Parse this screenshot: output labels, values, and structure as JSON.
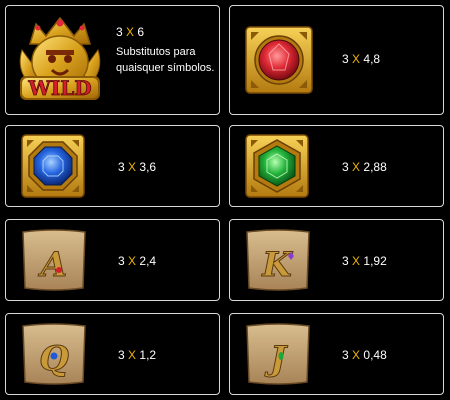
{
  "paytable": [
    {
      "symbol": "wild",
      "count": "3",
      "x": "X",
      "multiplier": "6",
      "description": "Substitutos para quaisquer símbolos."
    },
    {
      "symbol": "red-gem",
      "count": "3",
      "x": "X",
      "multiplier": "4,8"
    },
    {
      "symbol": "blue-gem",
      "count": "3",
      "x": "X",
      "multiplier": "3,6"
    },
    {
      "symbol": "green-gem",
      "count": "3",
      "x": "X",
      "multiplier": "2,88"
    },
    {
      "symbol": "letter-a",
      "count": "3",
      "x": "X",
      "multiplier": "2,4"
    },
    {
      "symbol": "letter-k",
      "count": "3",
      "x": "X",
      "multiplier": "1,92"
    },
    {
      "symbol": "letter-q",
      "count": "3",
      "x": "X",
      "multiplier": "1,2"
    },
    {
      "symbol": "letter-j",
      "count": "3",
      "x": "X",
      "multiplier": "0,48"
    }
  ],
  "tile_letters": {
    "a": "A",
    "k": "K",
    "q": "Q",
    "j": "J"
  },
  "wild_banner": "WILD",
  "colors": {
    "accent": "#f0b400",
    "gold": "#d9a21d",
    "parchment": "#c9a878",
    "ruby": "#d41e2e",
    "sapphire": "#1e5ad8",
    "emerald": "#1fa83a"
  }
}
